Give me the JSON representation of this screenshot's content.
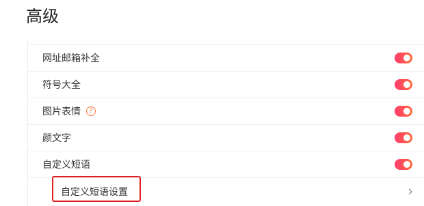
{
  "page": {
    "title": "高级"
  },
  "settings": {
    "items": [
      {
        "label": "网址邮箱补全",
        "toggle_on": true
      },
      {
        "label": "符号大全",
        "toggle_on": true
      },
      {
        "label": "图片表情",
        "toggle_on": true,
        "help_glyph": "?"
      },
      {
        "label": "颜文字",
        "toggle_on": true
      },
      {
        "label": "自定义短语",
        "toggle_on": true
      }
    ],
    "sub_item": {
      "label": "自定义短语设置",
      "chevron": "chevron-right-icon"
    }
  },
  "colors": {
    "accent_start": "#ff3d6e",
    "accent_end": "#ff6a3a",
    "highlight": "#e02020"
  }
}
